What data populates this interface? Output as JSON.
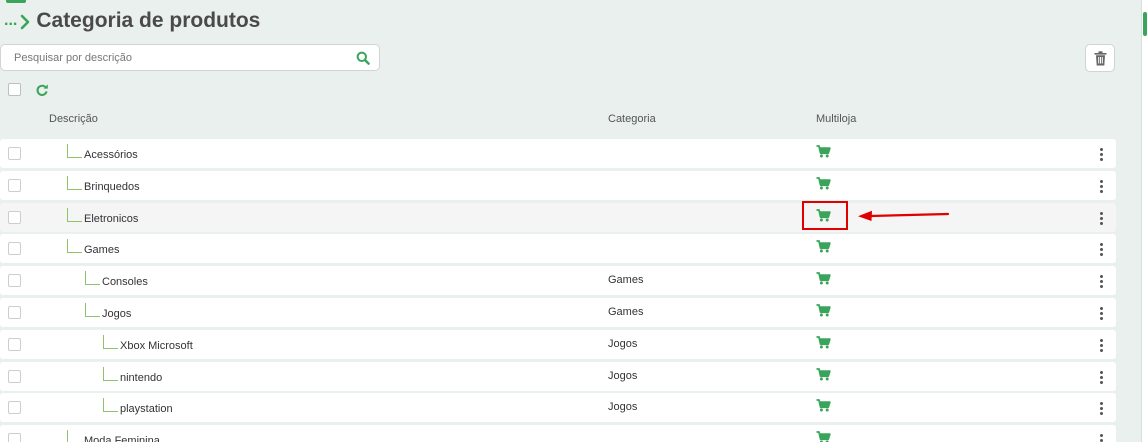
{
  "header": {
    "breadcrumb": "...",
    "title": "Categoria de produtos"
  },
  "search": {
    "placeholder": "Pesquisar por descrição"
  },
  "table": {
    "columns": {
      "description": "Descrição",
      "category": "Categoria",
      "multistore": "Multiloja"
    },
    "rows": [
      {
        "description": "Acessórios",
        "category": "",
        "level": 1,
        "multistore": true
      },
      {
        "description": "Brinquedos",
        "category": "",
        "level": 1,
        "multistore": true
      },
      {
        "description": "Eletronicos",
        "category": "",
        "level": 1,
        "multistore": true
      },
      {
        "description": "Games",
        "category": "",
        "level": 1,
        "multistore": true
      },
      {
        "description": "Consoles",
        "category": "Games",
        "level": 2,
        "multistore": true
      },
      {
        "description": "Jogos",
        "category": "Games",
        "level": 2,
        "multistore": true
      },
      {
        "description": "Xbox Microsoft",
        "category": "Jogos",
        "level": 3,
        "multistore": true
      },
      {
        "description": "nintendo",
        "category": "Jogos",
        "level": 3,
        "multistore": true
      },
      {
        "description": "playstation",
        "category": "Jogos",
        "level": 3,
        "multistore": true
      },
      {
        "description": "Moda Feminina",
        "category": "",
        "level": 1,
        "multistore": true
      }
    ]
  },
  "icons": {
    "cart": "shopping-cart-icon",
    "search": "search-icon",
    "trash": "trash-icon",
    "refresh": "refresh-icon",
    "menu": "kebab-menu-icon"
  },
  "colors": {
    "accent": "#3aa55a",
    "tree_line": "#8fc36a",
    "annotation": "#e00000"
  }
}
